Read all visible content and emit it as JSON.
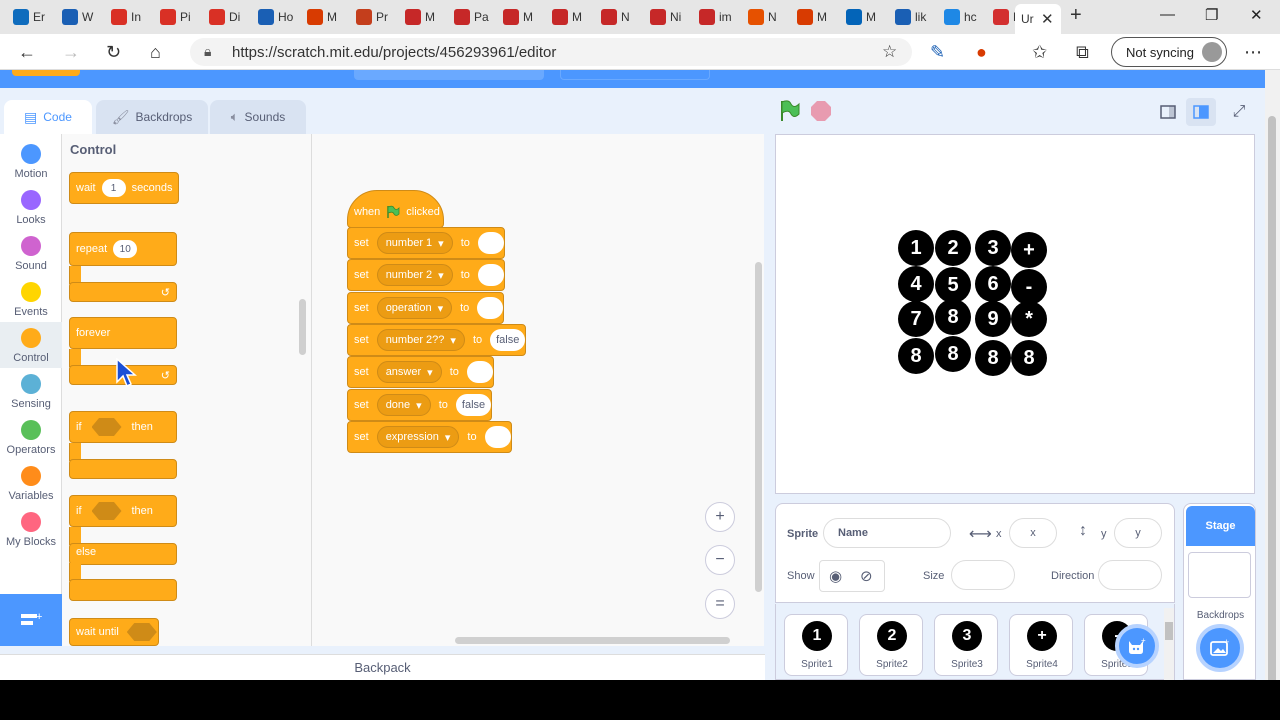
{
  "browser": {
    "tabs": [
      {
        "icon": "outlook-icon",
        "color": "#0f6cbd",
        "label": "Er"
      },
      {
        "icon": "word-icon",
        "color": "#1a5fb4",
        "label": "W"
      },
      {
        "icon": "gmail-icon",
        "color": "#d93025",
        "label": "In"
      },
      {
        "icon": "gmail-icon",
        "color": "#d93025",
        "label": "Pi"
      },
      {
        "icon": "gmail-icon",
        "color": "#d93025",
        "label": "Di"
      },
      {
        "icon": "contacts-icon",
        "color": "#1a5fb4",
        "label": "Ho"
      },
      {
        "icon": "office-icon",
        "color": "#d83b01",
        "label": "M"
      },
      {
        "icon": "powerpoint-icon",
        "color": "#c43e1c",
        "label": "Pr"
      },
      {
        "icon": "pdf-icon",
        "color": "#c62828",
        "label": "M"
      },
      {
        "icon": "pdf-icon",
        "color": "#c62828",
        "label": "Pa"
      },
      {
        "icon": "pdf-icon",
        "color": "#c62828",
        "label": "M"
      },
      {
        "icon": "pdf-icon",
        "color": "#c62828",
        "label": "M"
      },
      {
        "icon": "pdf-icon",
        "color": "#c62828",
        "label": "N"
      },
      {
        "icon": "pdf-icon",
        "color": "#c62828",
        "label": "Ni"
      },
      {
        "icon": "pdf-icon",
        "color": "#c62828",
        "label": "im"
      },
      {
        "icon": "sun-icon",
        "color": "#e65100",
        "label": "N"
      },
      {
        "icon": "office-icon",
        "color": "#d83b01",
        "label": "M"
      },
      {
        "icon": "onedrive-icon",
        "color": "#0364b8",
        "label": "M"
      },
      {
        "icon": "word-icon",
        "color": "#1a5fb4",
        "label": "lik"
      },
      {
        "icon": "bing-icon",
        "color": "#1e88e5",
        "label": "hc"
      },
      {
        "icon": "bpm-icon",
        "color": "#d32f2f",
        "label": "M"
      }
    ],
    "active_tab": {
      "label": "Ur",
      "icon": "scratch-icon"
    },
    "new_tab": "+",
    "url": "https://scratch.mit.edu/projects/456293961/editor",
    "sync_label": "Not syncing"
  },
  "editor": {
    "tabs": {
      "code": "Code",
      "backdrops": "Backdrops",
      "sounds": "Sounds"
    },
    "categories": [
      {
        "label": "Motion",
        "color": "#4c97ff"
      },
      {
        "label": "Looks",
        "color": "#9966ff"
      },
      {
        "label": "Sound",
        "color": "#cf63cf"
      },
      {
        "label": "Events",
        "color": "#ffd500"
      },
      {
        "label": "Control",
        "color": "#ffab19"
      },
      {
        "label": "Sensing",
        "color": "#5cb1d6"
      },
      {
        "label": "Operators",
        "color": "#59c059"
      },
      {
        "label": "Variables",
        "color": "#ff8c1a"
      },
      {
        "label": "My Blocks",
        "color": "#ff6680"
      }
    ],
    "palette": {
      "title": "Control",
      "wait": {
        "label": "wait",
        "value": "1",
        "unit": "seconds"
      },
      "repeat": {
        "label": "repeat",
        "value": "10"
      },
      "forever": "forever",
      "if_then": {
        "if": "if",
        "then": "then"
      },
      "if_else": {
        "if": "if",
        "then": "then",
        "else": "else"
      },
      "wait_until": "wait until"
    },
    "script": {
      "hat": {
        "when": "when",
        "clicked": "clicked"
      },
      "set_label": "set",
      "to_label": "to",
      "rows": [
        {
          "var": "number 1",
          "value": ""
        },
        {
          "var": "number 2",
          "value": ""
        },
        {
          "var": "operation",
          "value": ""
        },
        {
          "var": "number 2??",
          "value": "false"
        },
        {
          "var": "answer",
          "value": ""
        },
        {
          "var": "done",
          "value": "false"
        },
        {
          "var": "expression",
          "value": ""
        }
      ]
    },
    "zoom": {
      "in": "+",
      "out": "−",
      "reset": "="
    },
    "backpack": "Backpack"
  },
  "stage": {
    "keys": [
      [
        "1",
        "2",
        "3",
        "+"
      ],
      [
        "4",
        "5",
        "6",
        "-"
      ],
      [
        "7",
        "8",
        "9",
        "*"
      ],
      [
        "8",
        "8",
        "8",
        "8"
      ]
    ]
  },
  "sprite_info": {
    "sprite_label": "Sprite",
    "name_placeholder": "Name",
    "x_label": "x",
    "x_placeholder": "x",
    "y_label": "y",
    "y_placeholder": "y",
    "show_label": "Show",
    "size_label": "Size",
    "direction_label": "Direction"
  },
  "sprites": [
    {
      "name": "Sprite1",
      "glyph": "1"
    },
    {
      "name": "Sprite2",
      "glyph": "2"
    },
    {
      "name": "Sprite3",
      "glyph": "3"
    },
    {
      "name": "Sprite4",
      "glyph": "+"
    },
    {
      "name": "Sprite5",
      "glyph": "-"
    }
  ],
  "stage_pane": {
    "title": "Stage",
    "backdrops": "Backdrops"
  }
}
